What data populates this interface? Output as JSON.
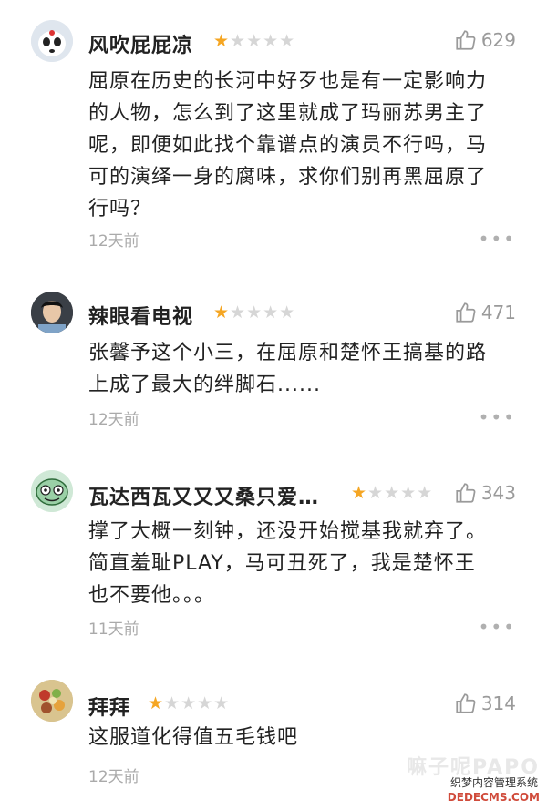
{
  "comments": [
    {
      "username": "风吹屁屁凉",
      "stars": "★",
      "stars_off": "★★★★",
      "likes": "629",
      "text": "屈原在历史的长河中好歹也是有一定影响力\n的人物，怎么到了这里就成了玛丽苏男主了\n呢，即便如此找个靠谱点的演员不行吗，马\n可的演绎一身的腐味，求你们别再黑屈原了\n行吗？",
      "date": "12天前",
      "more": "•••"
    },
    {
      "username": "辣眼看电视",
      "stars": "★",
      "stars_off": "★★★★",
      "likes": "471",
      "text": "张馨予这个小三，在屈原和楚怀王搞基的路\n上成了最大的绊脚石......",
      "date": "12天前",
      "more": "•••"
    },
    {
      "username": "瓦达西瓦又又又桑只爱…",
      "stars": "★",
      "stars_off": "★★★★",
      "likes": "343",
      "text": "撑了大概一刻钟，还没开始搅基我就弃了。\n简直羞耻PLAY，马可丑死了，我是楚怀王\n也不要他。。。",
      "date": "11天前",
      "more": "•••"
    },
    {
      "username": "拜拜",
      "stars": "★",
      "stars_off": "★★★★",
      "likes": "314",
      "text": "这服道化得值五毛钱吧",
      "date": "12天前",
      "more": ""
    }
  ],
  "watermark": {
    "main": "嘛子呢PAPO",
    "sub": "织梦内容管理系统",
    "url": "DEDECMS.COM"
  },
  "colors": {
    "star": "#f5a623",
    "muted": "#aaaaaa"
  }
}
